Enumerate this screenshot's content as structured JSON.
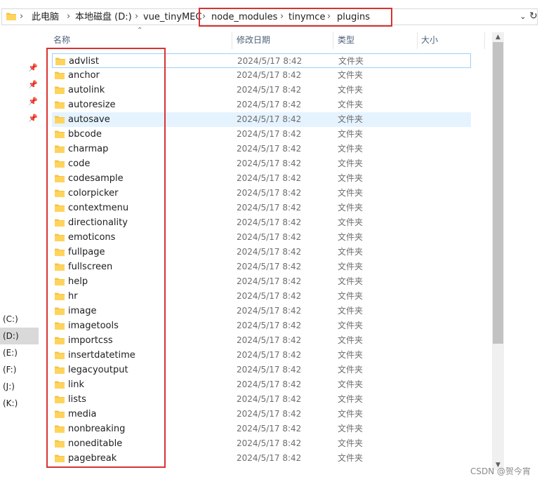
{
  "address_bar": {
    "crumbs": [
      "此电脑",
      "本地磁盘 (D:)",
      "vue_tinyMEC",
      "node_modules",
      "tinymce",
      "plugins"
    ],
    "separator": "›",
    "dropdown_icon": "chevron-down-icon",
    "refresh_icon": "refresh-icon"
  },
  "columns": {
    "name": "名称",
    "date": "修改日期",
    "type": "类型",
    "size": "大小"
  },
  "nav": {
    "drives": [
      "(C:)",
      "(D:)",
      "(E:)",
      "(F:)",
      "(J:)",
      "(K:)"
    ],
    "selected": "(D:)"
  },
  "files": [
    {
      "name": "advlist",
      "date": "2024/5/17 8:42",
      "type": "文件夹"
    },
    {
      "name": "anchor",
      "date": "2024/5/17 8:42",
      "type": "文件夹"
    },
    {
      "name": "autolink",
      "date": "2024/5/17 8:42",
      "type": "文件夹"
    },
    {
      "name": "autoresize",
      "date": "2024/5/17 8:42",
      "type": "文件夹"
    },
    {
      "name": "autosave",
      "date": "2024/5/17 8:42",
      "type": "文件夹"
    },
    {
      "name": "bbcode",
      "date": "2024/5/17 8:42",
      "type": "文件夹"
    },
    {
      "name": "charmap",
      "date": "2024/5/17 8:42",
      "type": "文件夹"
    },
    {
      "name": "code",
      "date": "2024/5/17 8:42",
      "type": "文件夹"
    },
    {
      "name": "codesample",
      "date": "2024/5/17 8:42",
      "type": "文件夹"
    },
    {
      "name": "colorpicker",
      "date": "2024/5/17 8:42",
      "type": "文件夹"
    },
    {
      "name": "contextmenu",
      "date": "2024/5/17 8:42",
      "type": "文件夹"
    },
    {
      "name": "directionality",
      "date": "2024/5/17 8:42",
      "type": "文件夹"
    },
    {
      "name": "emoticons",
      "date": "2024/5/17 8:42",
      "type": "文件夹"
    },
    {
      "name": "fullpage",
      "date": "2024/5/17 8:42",
      "type": "文件夹"
    },
    {
      "name": "fullscreen",
      "date": "2024/5/17 8:42",
      "type": "文件夹"
    },
    {
      "name": "help",
      "date": "2024/5/17 8:42",
      "type": "文件夹"
    },
    {
      "name": "hr",
      "date": "2024/5/17 8:42",
      "type": "文件夹"
    },
    {
      "name": "image",
      "date": "2024/5/17 8:42",
      "type": "文件夹"
    },
    {
      "name": "imagetools",
      "date": "2024/5/17 8:42",
      "type": "文件夹"
    },
    {
      "name": "importcss",
      "date": "2024/5/17 8:42",
      "type": "文件夹"
    },
    {
      "name": "insertdatetime",
      "date": "2024/5/17 8:42",
      "type": "文件夹"
    },
    {
      "name": "legacyoutput",
      "date": "2024/5/17 8:42",
      "type": "文件夹"
    },
    {
      "name": "link",
      "date": "2024/5/17 8:42",
      "type": "文件夹"
    },
    {
      "name": "lists",
      "date": "2024/5/17 8:42",
      "type": "文件夹"
    },
    {
      "name": "media",
      "date": "2024/5/17 8:42",
      "type": "文件夹"
    },
    {
      "name": "nonbreaking",
      "date": "2024/5/17 8:42",
      "type": "文件夹"
    },
    {
      "name": "noneditable",
      "date": "2024/5/17 8:42",
      "type": "文件夹"
    },
    {
      "name": "pagebreak",
      "date": "2024/5/17 8:42",
      "type": "文件夹"
    }
  ],
  "focused_index": 0,
  "hover_index": 4,
  "watermark": "CSDN @贺今宵",
  "colors": {
    "annotation_red": "#d93232",
    "hover_bg": "#e5f3ff",
    "folder_yellow": "#ffd45c"
  }
}
